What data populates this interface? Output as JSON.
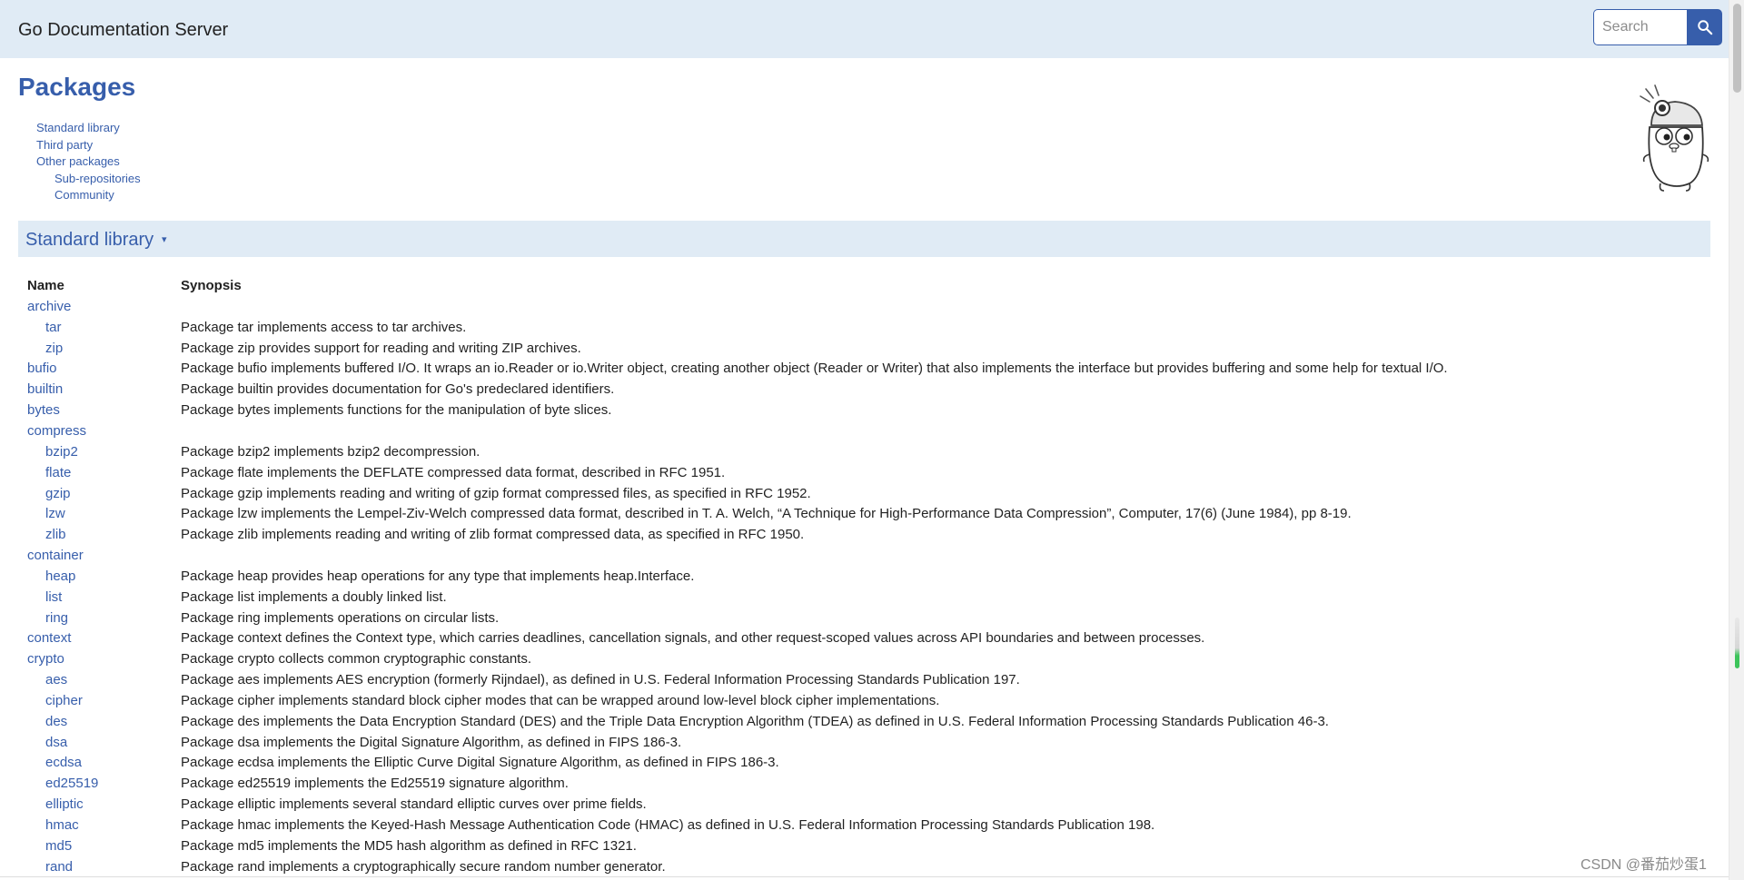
{
  "header": {
    "title": "Go Documentation Server",
    "search_placeholder": "Search"
  },
  "page_title": "Packages",
  "toc": [
    {
      "label": "Standard library",
      "sub": false
    },
    {
      "label": "Third party",
      "sub": false
    },
    {
      "label": "Other packages",
      "sub": false
    },
    {
      "label": "Sub-repositories",
      "sub": true
    },
    {
      "label": "Community",
      "sub": true
    }
  ],
  "section": {
    "title": "Standard library",
    "caret": "▾"
  },
  "table": {
    "headers": {
      "name": "Name",
      "synopsis": "Synopsis"
    },
    "rows": [
      {
        "name": "archive",
        "child": false,
        "synopsis": ""
      },
      {
        "name": "tar",
        "child": true,
        "synopsis": "Package tar implements access to tar archives."
      },
      {
        "name": "zip",
        "child": true,
        "synopsis": "Package zip provides support for reading and writing ZIP archives."
      },
      {
        "name": "bufio",
        "child": false,
        "synopsis": "Package bufio implements buffered I/O. It wraps an io.Reader or io.Writer object, creating another object (Reader or Writer) that also implements the interface but provides buffering and some help for textual I/O."
      },
      {
        "name": "builtin",
        "child": false,
        "synopsis": "Package builtin provides documentation for Go's predeclared identifiers."
      },
      {
        "name": "bytes",
        "child": false,
        "synopsis": "Package bytes implements functions for the manipulation of byte slices."
      },
      {
        "name": "compress",
        "child": false,
        "synopsis": ""
      },
      {
        "name": "bzip2",
        "child": true,
        "synopsis": "Package bzip2 implements bzip2 decompression."
      },
      {
        "name": "flate",
        "child": true,
        "synopsis": "Package flate implements the DEFLATE compressed data format, described in RFC 1951."
      },
      {
        "name": "gzip",
        "child": true,
        "synopsis": "Package gzip implements reading and writing of gzip format compressed files, as specified in RFC 1952."
      },
      {
        "name": "lzw",
        "child": true,
        "synopsis": "Package lzw implements the Lempel-Ziv-Welch compressed data format, described in T. A. Welch, “A Technique for High-Performance Data Compression”, Computer, 17(6) (June 1984), pp 8-19."
      },
      {
        "name": "zlib",
        "child": true,
        "synopsis": "Package zlib implements reading and writing of zlib format compressed data, as specified in RFC 1950."
      },
      {
        "name": "container",
        "child": false,
        "synopsis": ""
      },
      {
        "name": "heap",
        "child": true,
        "synopsis": "Package heap provides heap operations for any type that implements heap.Interface."
      },
      {
        "name": "list",
        "child": true,
        "synopsis": "Package list implements a doubly linked list."
      },
      {
        "name": "ring",
        "child": true,
        "synopsis": "Package ring implements operations on circular lists."
      },
      {
        "name": "context",
        "child": false,
        "synopsis": "Package context defines the Context type, which carries deadlines, cancellation signals, and other request-scoped values across API boundaries and between processes."
      },
      {
        "name": "crypto",
        "child": false,
        "synopsis": "Package crypto collects common cryptographic constants."
      },
      {
        "name": "aes",
        "child": true,
        "synopsis": "Package aes implements AES encryption (formerly Rijndael), as defined in U.S. Federal Information Processing Standards Publication 197."
      },
      {
        "name": "cipher",
        "child": true,
        "synopsis": "Package cipher implements standard block cipher modes that can be wrapped around low-level block cipher implementations."
      },
      {
        "name": "des",
        "child": true,
        "synopsis": "Package des implements the Data Encryption Standard (DES) and the Triple Data Encryption Algorithm (TDEA) as defined in U.S. Federal Information Processing Standards Publication 46-3."
      },
      {
        "name": "dsa",
        "child": true,
        "synopsis": "Package dsa implements the Digital Signature Algorithm, as defined in FIPS 186-3."
      },
      {
        "name": "ecdsa",
        "child": true,
        "synopsis": "Package ecdsa implements the Elliptic Curve Digital Signature Algorithm, as defined in FIPS 186-3."
      },
      {
        "name": "ed25519",
        "child": true,
        "synopsis": "Package ed25519 implements the Ed25519 signature algorithm."
      },
      {
        "name": "elliptic",
        "child": true,
        "synopsis": "Package elliptic implements several standard elliptic curves over prime fields."
      },
      {
        "name": "hmac",
        "child": true,
        "synopsis": "Package hmac implements the Keyed-Hash Message Authentication Code (HMAC) as defined in U.S. Federal Information Processing Standards Publication 198."
      },
      {
        "name": "md5",
        "child": true,
        "synopsis": "Package md5 implements the MD5 hash algorithm as defined in RFC 1321."
      },
      {
        "name": "rand",
        "child": true,
        "synopsis": "Package rand implements a cryptographically secure random number generator."
      }
    ]
  },
  "watermark": "CSDN @番茄炒蛋1",
  "colors": {
    "accent": "#375eab",
    "bar_bg": "#e0ebf5",
    "text": "#222222"
  },
  "icons": {
    "search": "search-icon",
    "mascot": "gopher-mascot-icon"
  }
}
